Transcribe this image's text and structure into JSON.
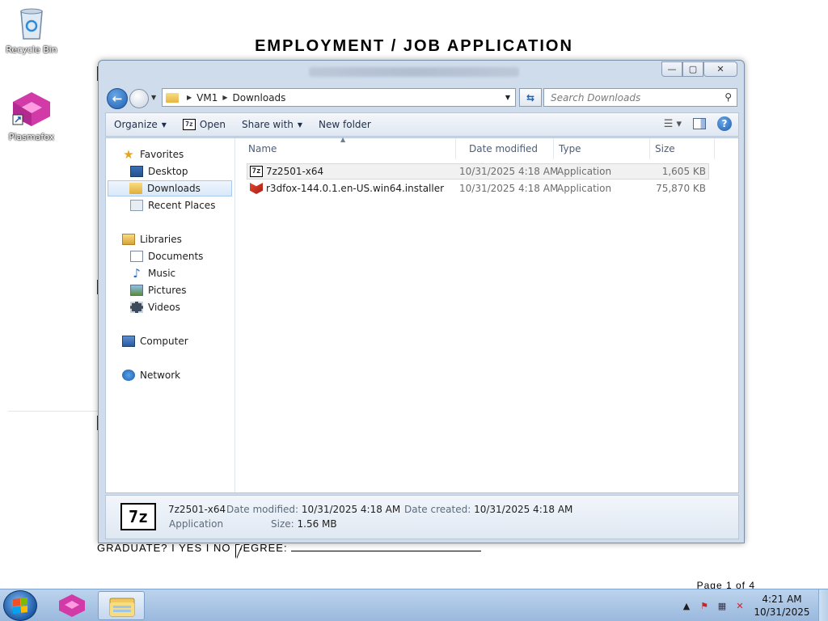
{
  "document": {
    "title": "EMPLOYMENT / JOB APPLICATION",
    "graduate_line": "GRADUATE? I YES I NO DEGREE:",
    "page_footer": "Page 1 of 4"
  },
  "desktop": {
    "icons": [
      {
        "label": "Recycle Bin",
        "icon": "recycle-bin-icon"
      },
      {
        "label": "Plasmafox",
        "icon": "plasmafox-icon"
      }
    ]
  },
  "window": {
    "buttons": {
      "minimize": "—",
      "maximize": "▢",
      "close": "✕"
    }
  },
  "address": {
    "segments": [
      "VM1",
      "Downloads"
    ],
    "search_placeholder": "Search Downloads"
  },
  "commands": {
    "organize": "Organize",
    "open": "Open",
    "share_with": "Share with",
    "new_folder": "New folder"
  },
  "nav": {
    "favorites": "Favorites",
    "desktop": "Desktop",
    "downloads": "Downloads",
    "recent_places": "Recent Places",
    "libraries": "Libraries",
    "documents": "Documents",
    "music": "Music",
    "pictures": "Pictures",
    "videos": "Videos",
    "computer": "Computer",
    "network": "Network"
  },
  "columns": {
    "name": "Name",
    "date_modified": "Date modified",
    "type": "Type",
    "size": "Size"
  },
  "files": [
    {
      "name": "7z2501-x64",
      "date": "10/31/2025 4:18 AM",
      "type": "Application",
      "size": "1,605 KB",
      "icon": "7zip-icon"
    },
    {
      "name": "r3dfox-144.0.1.en-US.win64.installer",
      "date": "10/31/2025 4:18 AM",
      "type": "Application",
      "size": "75,870 KB",
      "icon": "r3dfox-icon"
    }
  ],
  "details": {
    "name": "7z2501-x64",
    "kind": "Application",
    "date_modified_label": "Date modified:",
    "date_modified": "10/31/2025 4:18 AM",
    "date_created_label": "Date created:",
    "date_created": "10/31/2025 4:18 AM",
    "size_label": "Size:",
    "size": "1.56 MB"
  },
  "taskbar": {
    "time": "4:21 AM",
    "date": "10/31/2025"
  }
}
